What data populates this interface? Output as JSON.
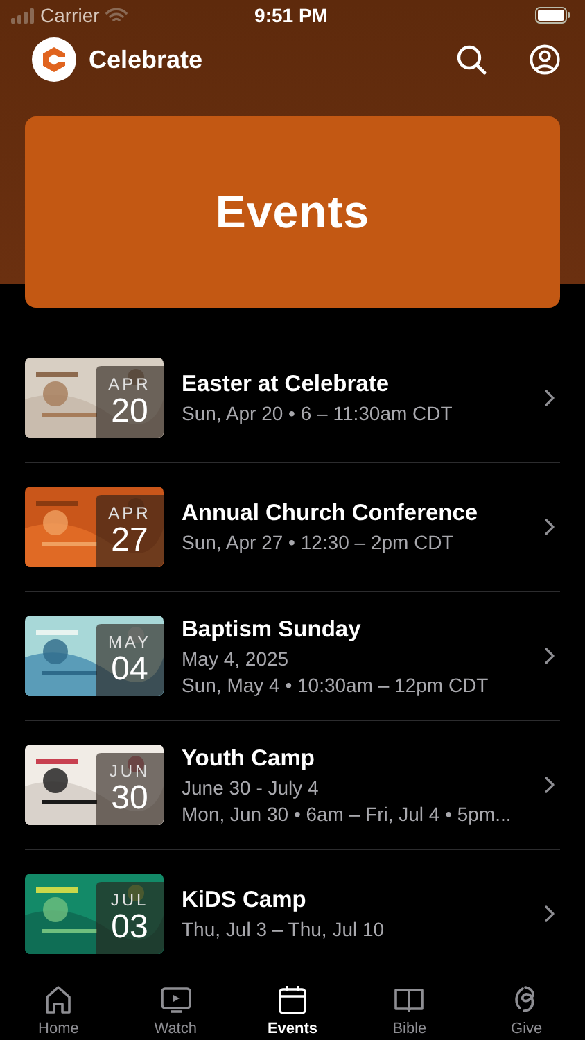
{
  "status_bar": {
    "carrier": "Carrier",
    "time": "9:51 PM"
  },
  "header": {
    "title": "Celebrate"
  },
  "banner": {
    "title": "Events"
  },
  "events": [
    {
      "title": "Easter at Celebrate",
      "month": "APR",
      "day": "20",
      "lines": [
        "Sun, Apr 20 • 6 – 11:30am CDT"
      ]
    },
    {
      "title": "Annual Church Conference",
      "month": "APR",
      "day": "27",
      "lines": [
        "Sun, Apr 27 • 12:30 – 2pm CDT"
      ]
    },
    {
      "title": "Baptism Sunday",
      "month": "MAY",
      "day": "04",
      "lines": [
        "May 4, 2025",
        "Sun, May 4 • 10:30am – 12pm CDT"
      ]
    },
    {
      "title": "Youth Camp",
      "month": "JUN",
      "day": "30",
      "lines": [
        "June 30 - July 4",
        "Mon, Jun 30 • 6am – Fri, Jul 4 • 5pm..."
      ]
    },
    {
      "title": "KiDS Camp",
      "month": "JUL",
      "day": "03",
      "lines": [
        "Thu, Jul 3 – Thu, Jul 10"
      ]
    }
  ],
  "tabs": [
    {
      "label": "Home",
      "selected": false
    },
    {
      "label": "Watch",
      "selected": false
    },
    {
      "label": "Events",
      "selected": true
    },
    {
      "label": "Bible",
      "selected": false
    },
    {
      "label": "Give",
      "selected": false
    }
  ]
}
